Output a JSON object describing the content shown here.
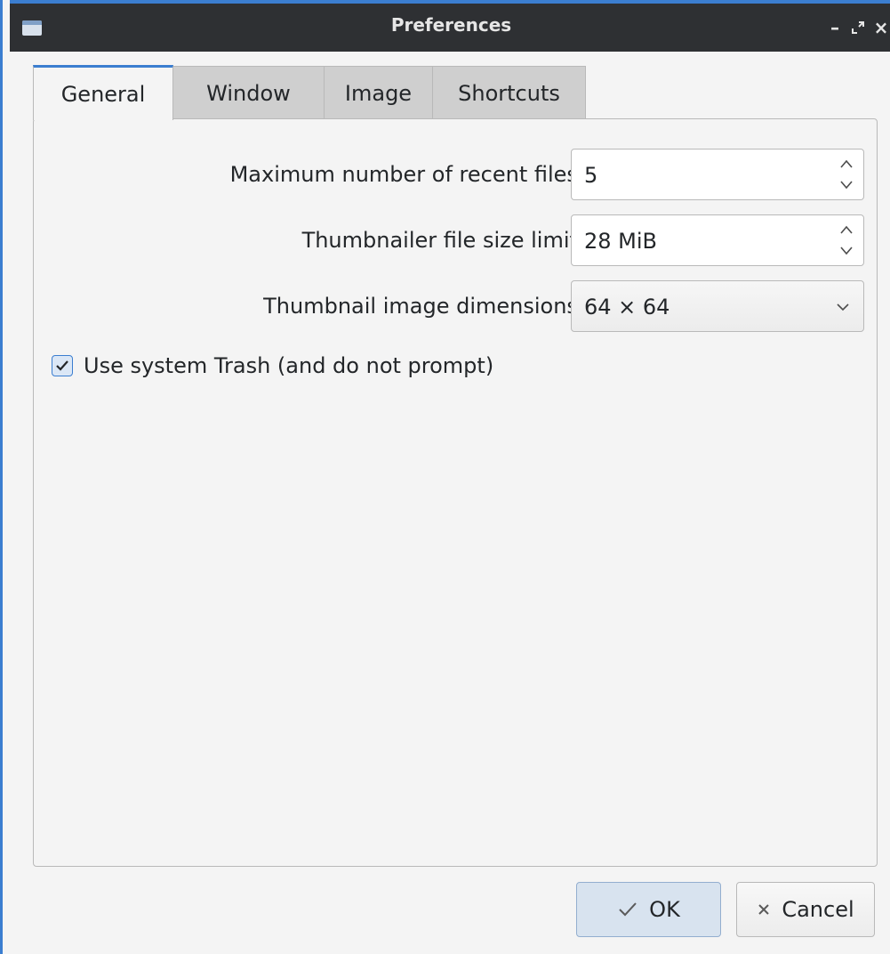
{
  "window": {
    "title": "Preferences"
  },
  "title_controls": {
    "minimize": "–",
    "restore": "⤢",
    "close": "×"
  },
  "tabs": [
    {
      "label": "General",
      "active": true
    },
    {
      "label": "Window",
      "active": false
    },
    {
      "label": "Image",
      "active": false
    },
    {
      "label": "Shortcuts",
      "active": false
    }
  ],
  "general": {
    "recent_files": {
      "label": "Maximum number of recent files:",
      "value": "5"
    },
    "thumbnailer_limit": {
      "label": "Thumbnailer file size limit:",
      "value": "28 MiB"
    },
    "thumbnail_dimensions": {
      "label": "Thumbnail image dimensions:",
      "value": "64 × 64"
    },
    "use_trash": {
      "label": "Use system Trash (and do not prompt)",
      "checked": true
    }
  },
  "buttons": {
    "ok": "OK",
    "cancel": "Cancel"
  },
  "colors": {
    "accent": "#3b7ed0",
    "titlebar": "#2e3033",
    "background": "#f4f4f4"
  },
  "icons": {
    "app": "window-icon",
    "minimize": "minimize-icon",
    "restore": "restore-icon",
    "close": "close-icon",
    "spin_up": "chevron-up-icon",
    "spin_down": "chevron-down-icon",
    "combo": "chevron-down-icon",
    "check": "checkmark-icon",
    "ok": "checkmark-icon",
    "cancel": "x-icon"
  }
}
